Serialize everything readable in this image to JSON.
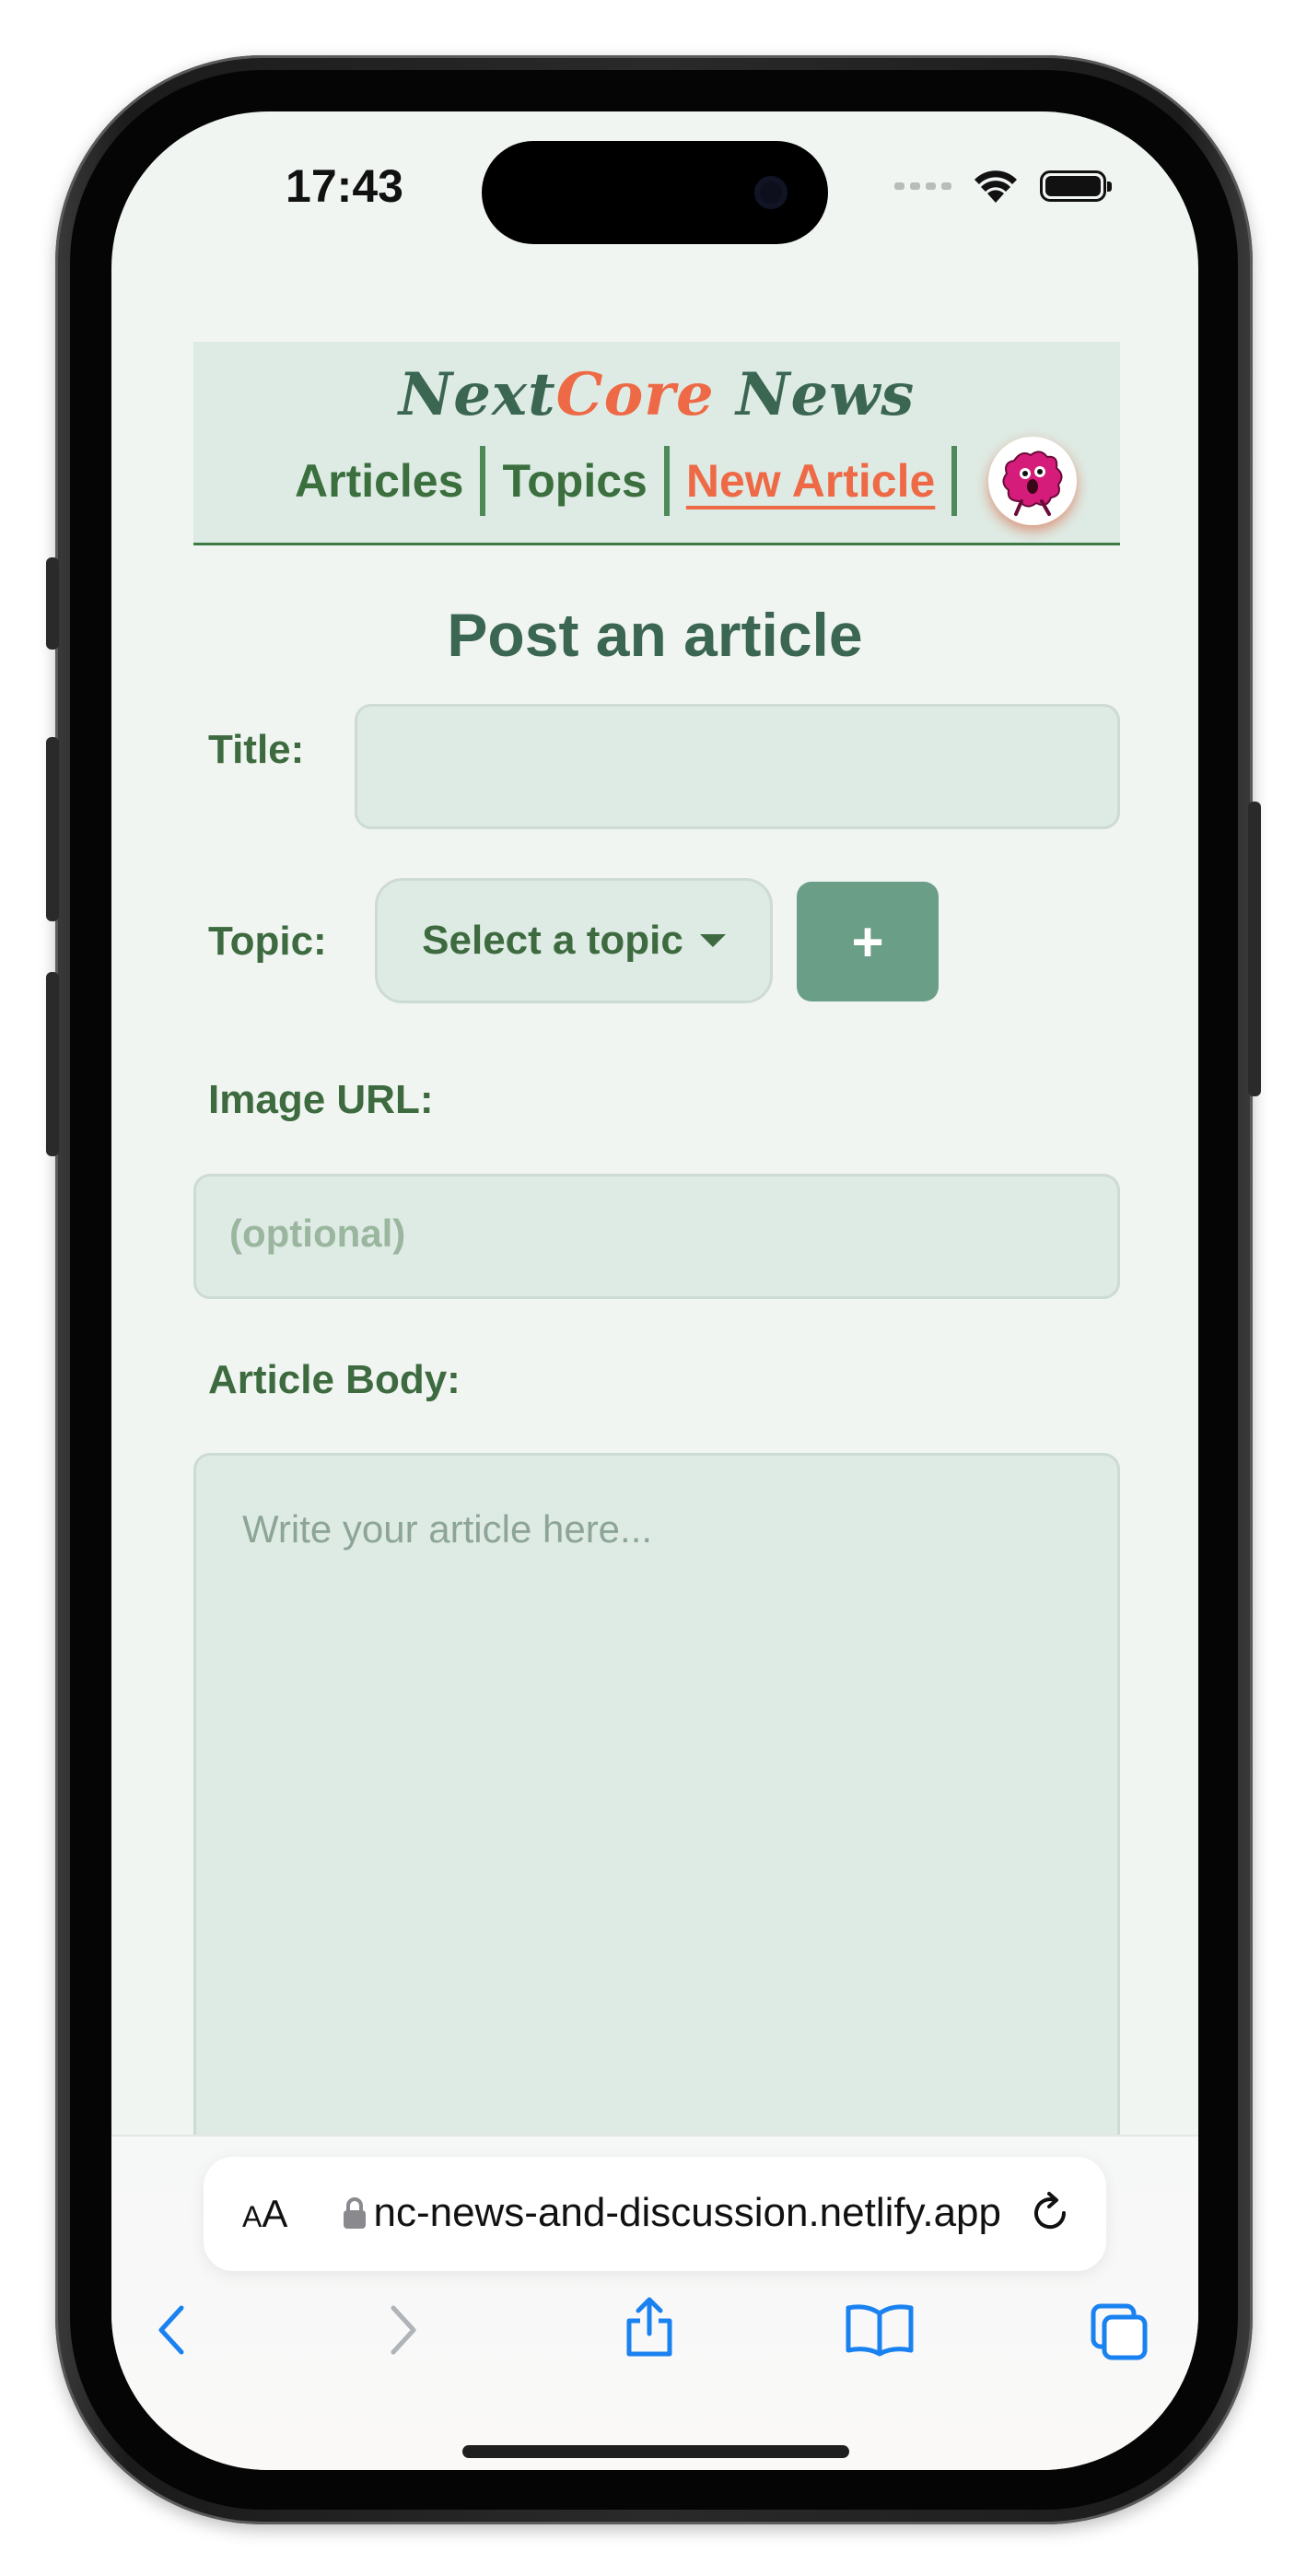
{
  "status_bar": {
    "time": "17:43"
  },
  "header": {
    "title_part1": "Next",
    "title_accent": "Core",
    "title_part2": " News",
    "nav": [
      {
        "label": "Articles"
      },
      {
        "label": "Topics"
      },
      {
        "label": "New Article",
        "active": true
      }
    ]
  },
  "form": {
    "heading": "Post an article",
    "title_label": "Title:",
    "title_value": "",
    "topic_label": "Topic:",
    "topic_select": "Select a topic",
    "add_topic_label": "+",
    "image_url_label": "Image URL:",
    "image_url_placeholder": "(optional)",
    "body_label": "Article Body:",
    "body_placeholder": "Write your article here..."
  },
  "browser": {
    "aa_label": "AA",
    "url": "nc-news-and-discussion.netlify.app"
  },
  "colors": {
    "accent": "#ee6a47",
    "brand_green": "#3b6652",
    "field_bg": "#deebe4",
    "button_green": "#6a9e87",
    "safari_blue": "#1a82f0"
  },
  "icons": [
    "wifi-icon",
    "battery-icon",
    "lock-icon",
    "reload-icon",
    "back-icon",
    "forward-icon",
    "share-icon",
    "bookmarks-icon",
    "tabs-icon",
    "caret-down-icon"
  ]
}
